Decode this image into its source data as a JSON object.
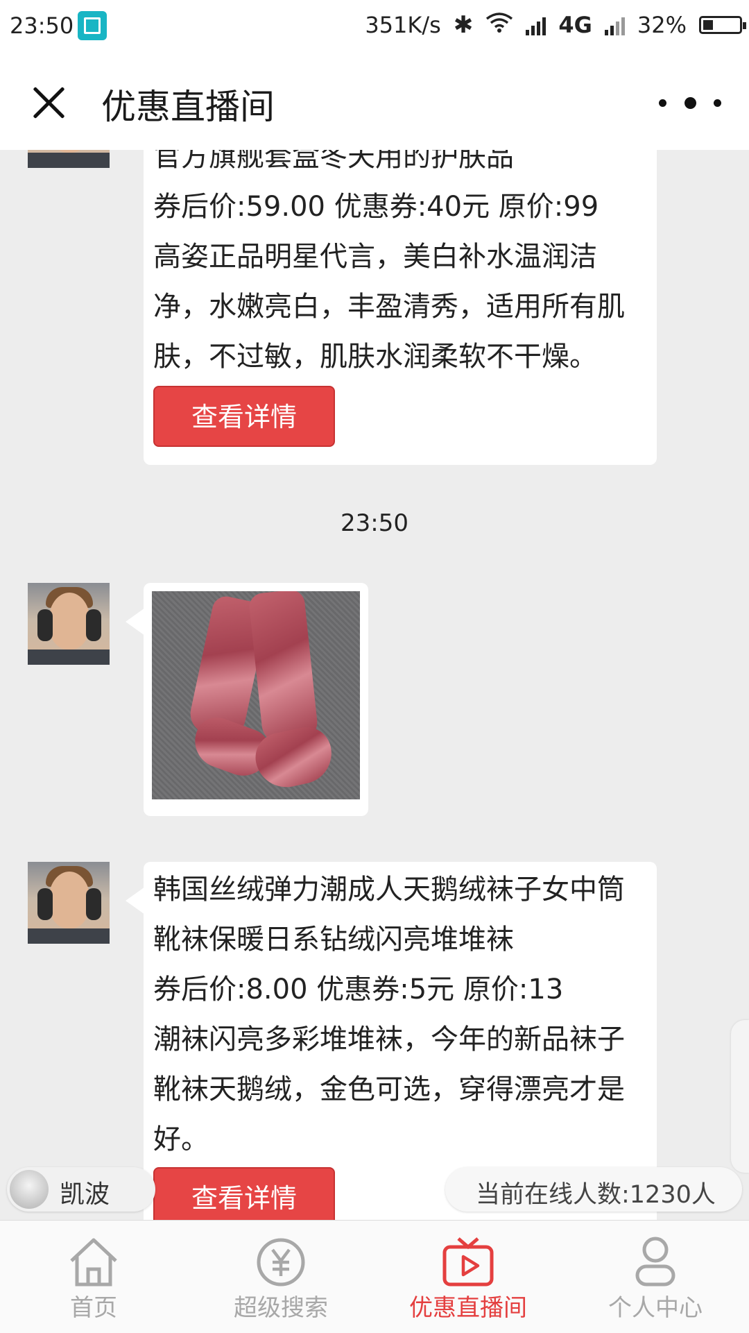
{
  "status_bar": {
    "time": "23:50",
    "network_speed": "351K/s",
    "network_type": "4G",
    "battery": "32%"
  },
  "header": {
    "title": "优惠直播间"
  },
  "messages": {
    "m1": {
      "title": "官方旗舰套盒冬天用的护肤品",
      "price_line": "券后价:59.00 优惠券:40元 原价:99",
      "description": "高姿正品明星代言，美白补水温润洁净，水嫩亮白，丰盈清秀，适用所有肌肤，不过敏，肌肤水润柔软不干燥。",
      "button": "查看详情"
    },
    "timestamp": "23:50",
    "m3": {
      "title": "韩国丝绒弹力潮成人天鹅绒袜子女中筒靴袜保暖日系钻绒闪亮堆堆袜",
      "price_line": "券后价:8.00 优惠券:5元 原价:13",
      "description": "潮袜闪亮多彩堆堆袜，今年的新品袜子靴袜天鹅绒，金色可选，穿得漂亮才是好。",
      "button": "查看详情"
    }
  },
  "floating": {
    "user_name": "凯波",
    "online_count": "当前在线人数:1230人"
  },
  "tabbar": {
    "tabs": [
      "首页",
      "超级搜索",
      "优惠直播间",
      "个人中心"
    ],
    "active_index": 2
  },
  "colors": {
    "accent_red": "#e64545",
    "active_tab": "#e43f3f",
    "inactive_tab": "#a8a8a8",
    "chat_bg": "#ededed"
  }
}
